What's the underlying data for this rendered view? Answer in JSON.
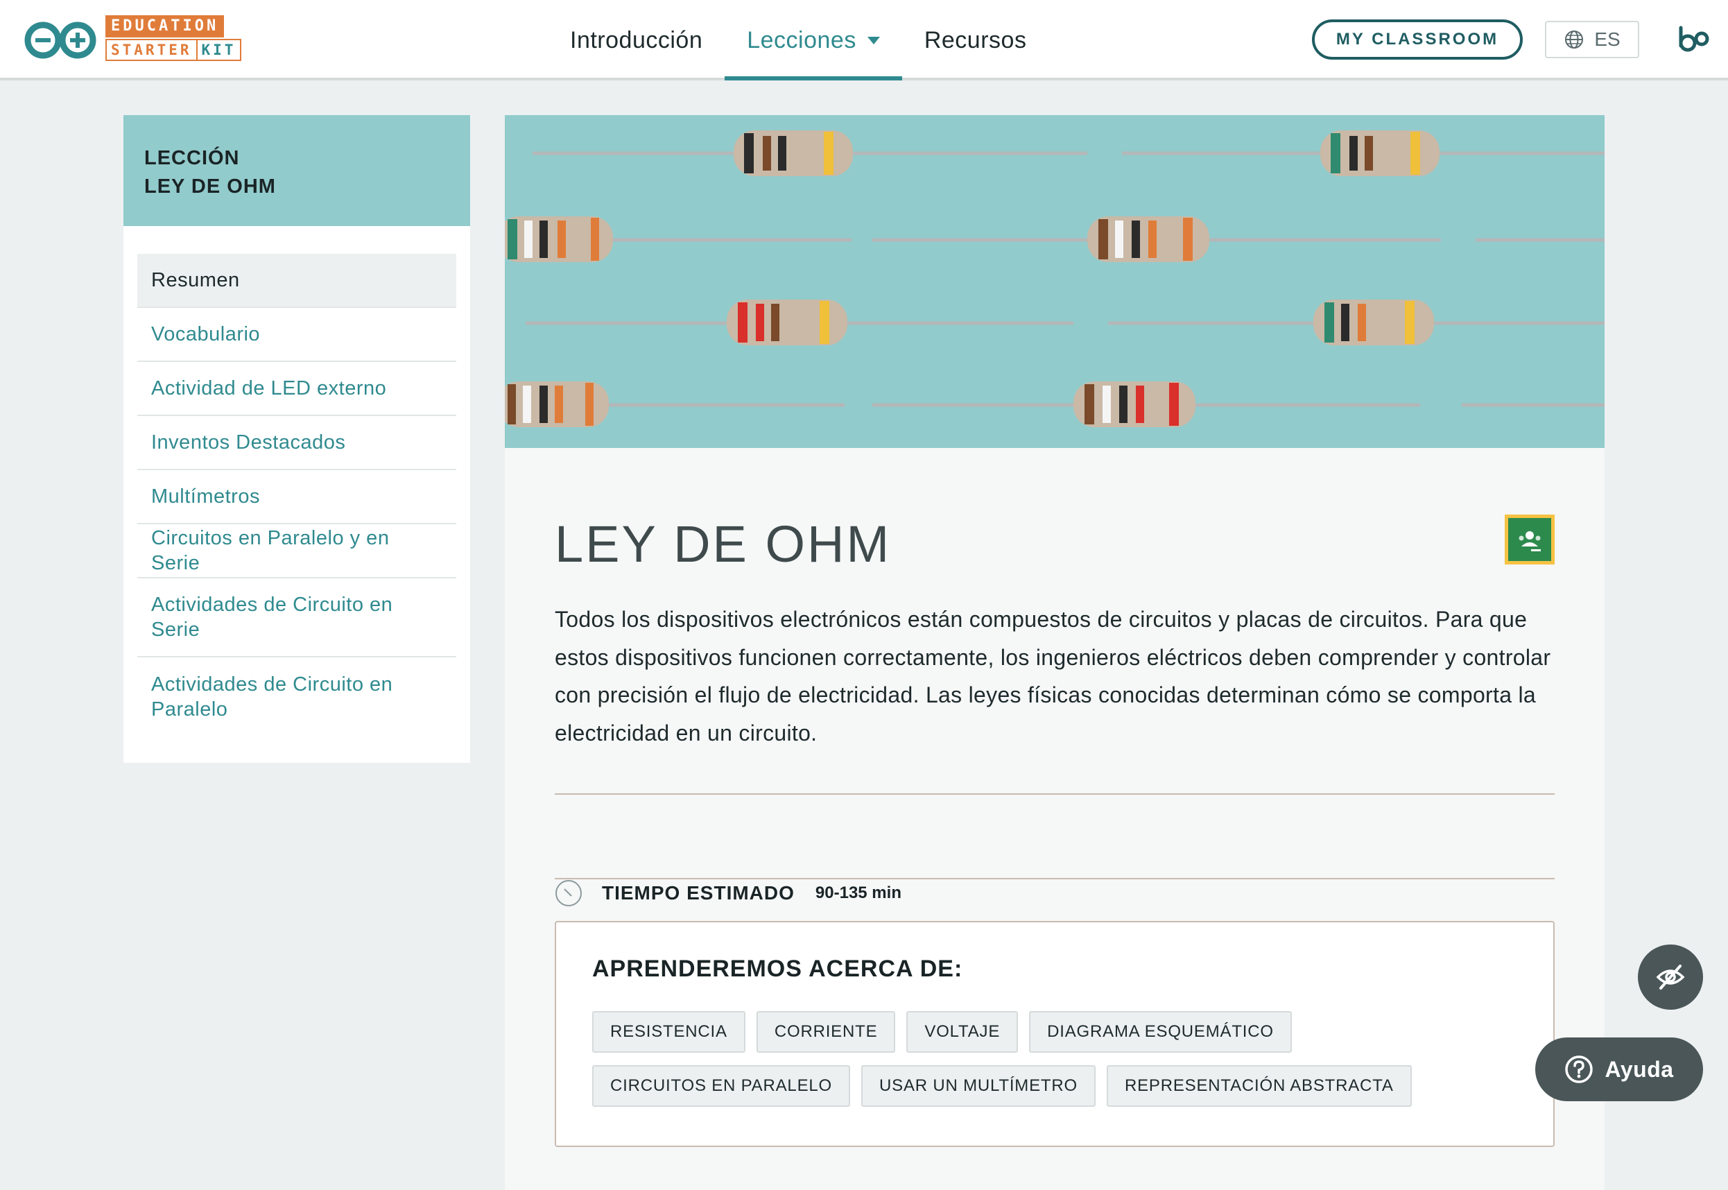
{
  "header": {
    "logo": {
      "line1": "EDUCATION",
      "line2a": "STARTER",
      "line2b": "KIT"
    },
    "nav": [
      {
        "label": "Introducción"
      },
      {
        "label": "Lecciones"
      },
      {
        "label": "Recursos"
      }
    ],
    "classroom_button": "MY CLASSROOM",
    "language": "ES"
  },
  "sidebar": {
    "heading_line1": "LECCIÓN",
    "heading_line2": "LEY DE OHM",
    "items": [
      {
        "label": "Resumen"
      },
      {
        "label": "Vocabulario"
      },
      {
        "label": "Actividad de LED externo"
      },
      {
        "label": "Inventos Destacados"
      },
      {
        "label": "Multímetros"
      },
      {
        "label": "Circuitos en Paralelo y en Serie"
      },
      {
        "label": "Actividades de Circuito en Serie"
      },
      {
        "label": "Actividades de Circuito en Paralelo"
      }
    ]
  },
  "main": {
    "title": "LEY DE OHM",
    "description": "Todos los dispositivos electrónicos están compuestos de circuitos y placas de circuitos. Para que estos dispositivos funcionen correctamente, los ingenieros eléctricos deben comprender y controlar con precisión el flujo de electricidad. Las leyes físicas conocidas determinan cómo se comporta la electricidad en un circuito.",
    "time_label": "TIEMPO ESTIMADO",
    "time_value": "90-135 min",
    "learn_title": "APRENDEREMOS ACERCA DE:",
    "tags": [
      "RESISTENCIA",
      "CORRIENTE",
      "VOLTAJE",
      "DIAGRAMA ESQUEMÁTICO",
      "CIRCUITOS EN PARALELO",
      "USAR UN MULTÍMETRO",
      "REPRESENTACIÓN ABSTRACTA"
    ]
  },
  "floating": {
    "help_label": "Ayuda"
  },
  "colors": {
    "accent": "#2f8a8f",
    "brand_orange": "#e07c3a",
    "sidebar_header": "#92cbcc",
    "floating_dark": "#4a5658"
  },
  "icons": [
    "arduino-infinity-icon",
    "globe-icon",
    "bo-logo-icon",
    "chevron-down-icon",
    "google-classroom-icon",
    "clock-icon",
    "eye-slash-icon",
    "question-circle-icon"
  ]
}
